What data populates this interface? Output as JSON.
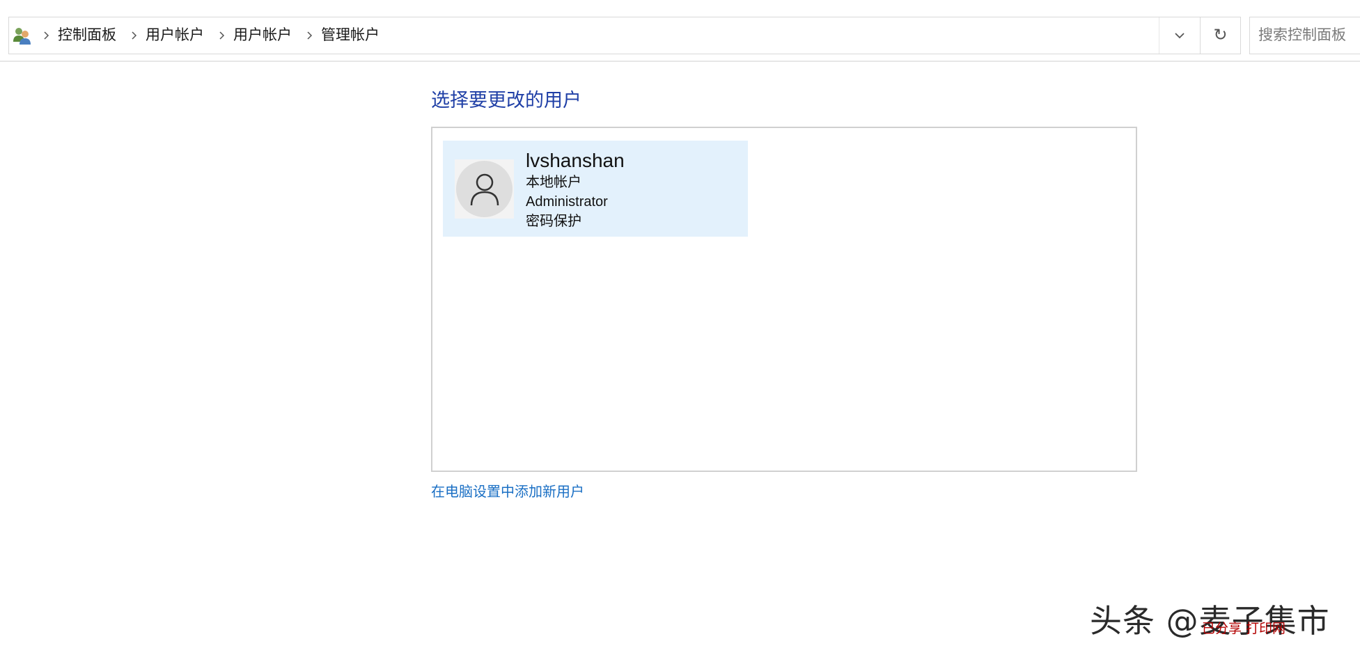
{
  "breadcrumb": {
    "items": [
      "控制面板",
      "用户帐户",
      "用户帐户",
      "管理帐户"
    ]
  },
  "search": {
    "placeholder": "搜索控制面板"
  },
  "icons": {
    "breadcrumb_root": "users-icon",
    "separator": "chevron-right-icon",
    "dropdown": "chevron-down-icon",
    "refresh": "refresh-icon",
    "avatar": "person-icon"
  },
  "refresh_glyph": "↻",
  "main": {
    "title": "选择要更改的用户",
    "users": [
      {
        "name": "lvshanshan",
        "account_type": "本地帐户",
        "role": "Administrator",
        "status": "密码保护"
      }
    ],
    "add_user_link": "在电脑设置中添加新用户"
  },
  "watermark": {
    "text": "头条 @麦子集市",
    "subtext": "已分享 打印网"
  },
  "colors": {
    "title": "#1f3fa6",
    "link": "#1a6fc4",
    "tile_bg": "#e3f1fc"
  }
}
